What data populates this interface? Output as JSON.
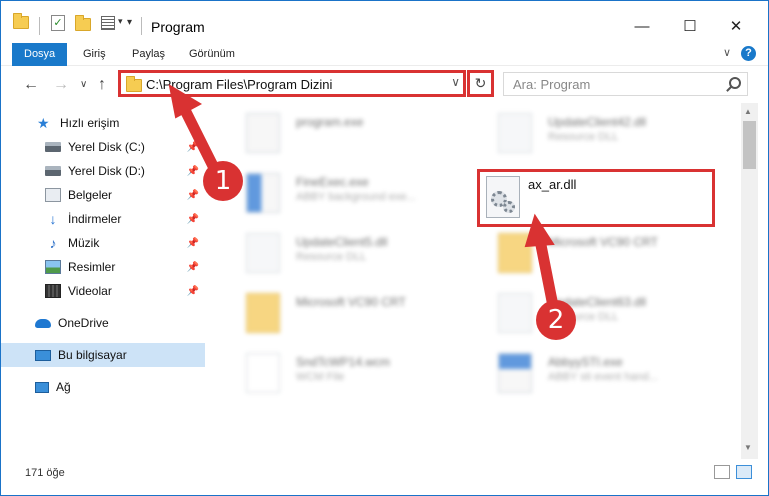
{
  "window": {
    "title": "Program"
  },
  "tabs": [
    {
      "label": "Dosya"
    },
    {
      "label": "Giriş"
    },
    {
      "label": "Paylaş"
    },
    {
      "label": "Görünüm"
    }
  ],
  "address": {
    "path": "C:\\Program Files\\Program Dizini"
  },
  "search": {
    "placeholder": "Ara: Program"
  },
  "sidebar": {
    "items": [
      {
        "label": "Hızlı erişim",
        "icon": "star-icon"
      },
      {
        "label": "Yerel Disk (C:)",
        "icon": "drive-icon",
        "pinned": true
      },
      {
        "label": "Yerel Disk (D:)",
        "icon": "drive-icon",
        "pinned": true
      },
      {
        "label": "Belgeler",
        "icon": "documents-icon",
        "pinned": true
      },
      {
        "label": "İndirmeler",
        "icon": "downloads-icon",
        "pinned": true
      },
      {
        "label": "Müzik",
        "icon": "music-icon",
        "pinned": true
      },
      {
        "label": "Resimler",
        "icon": "pictures-icon",
        "pinned": true
      },
      {
        "label": "Videolar",
        "icon": "videos-icon",
        "pinned": true
      },
      {
        "label": "OneDrive",
        "icon": "cloud-icon"
      },
      {
        "label": "Bu bilgisayar",
        "icon": "computer-icon",
        "selected": true
      },
      {
        "label": "Ağ",
        "icon": "network-icon"
      }
    ]
  },
  "files": [
    {
      "name": "program.exe",
      "sub": ""
    },
    {
      "name": "UpdateClient42.dll",
      "sub": "Resource DLL"
    },
    {
      "name": "FineExec.exe",
      "sub": "ABBY background exe..."
    },
    {
      "name": "ax_ar.dll",
      "sub": ""
    },
    {
      "name": "UpdateClient5.dll",
      "sub": "Resource DLL"
    },
    {
      "name": "Microsoft VC90 CRT",
      "sub": ""
    },
    {
      "name": "Microsoft VC90 CRT",
      "sub": ""
    },
    {
      "name": "UpdateClient63.dll",
      "sub": "Resource DLL"
    },
    {
      "name": "SndTcWP14.wcm",
      "sub": "WCM File"
    },
    {
      "name": "AbbyySTI.exe",
      "sub": "ABBY sti event hand..."
    }
  ],
  "status": {
    "count_text": "171 öğe"
  },
  "annotations": {
    "step1": "1",
    "step2": "2",
    "color": "#d93232"
  }
}
